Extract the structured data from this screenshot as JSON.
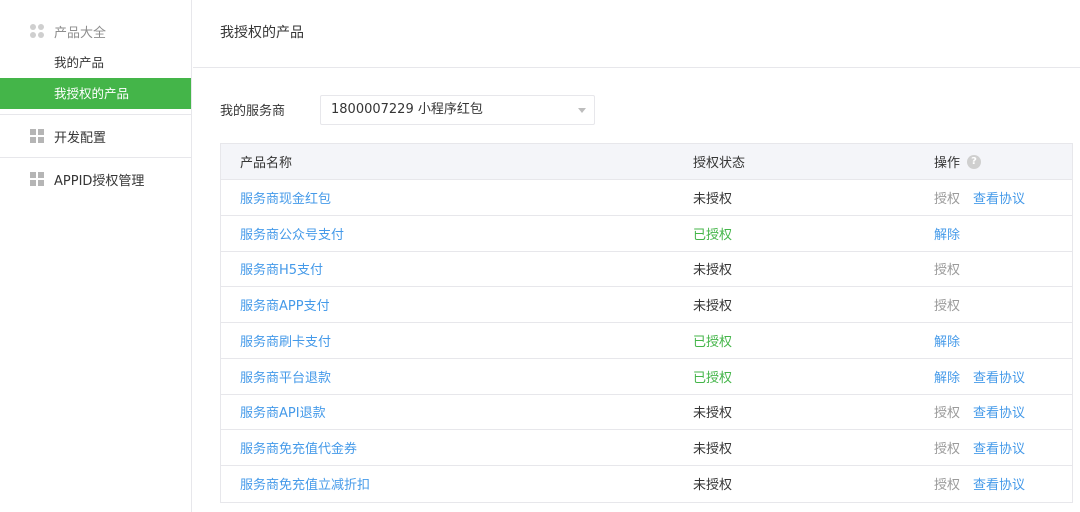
{
  "sidebar": {
    "section_title": "产品大全",
    "sub_items": [
      "我的产品",
      "我授权的产品"
    ],
    "groups": [
      "开发配置",
      "APPID授权管理"
    ]
  },
  "main": {
    "title": "我授权的产品",
    "provider_label": "我的服务商",
    "provider_value": "1800007229 小程序红包"
  },
  "table": {
    "headers": [
      "产品名称",
      "授权状态",
      "操作"
    ],
    "rows": [
      {
        "name": "服务商现金红包",
        "status": "未授权",
        "ops": [
          "授权",
          "查看协议"
        ]
      },
      {
        "name": "服务商公众号支付",
        "status": "已授权",
        "ops": [
          "解除"
        ]
      },
      {
        "name": "服务商H5支付",
        "status": "未授权",
        "ops": [
          "授权"
        ]
      },
      {
        "name": "服务商APP支付",
        "status": "未授权",
        "ops": [
          "授权"
        ]
      },
      {
        "name": "服务商刷卡支付",
        "status": "已授权",
        "ops": [
          "解除"
        ]
      },
      {
        "name": "服务商平台退款",
        "status": "已授权",
        "ops": [
          "解除",
          "查看协议"
        ]
      },
      {
        "name": "服务商API退款",
        "status": "未授权",
        "ops": [
          "授权",
          "查看协议"
        ]
      },
      {
        "name": "服务商免充值代金券",
        "status": "未授权",
        "ops": [
          "授权",
          "查看协议"
        ]
      },
      {
        "name": "服务商免充值立减折扣",
        "status": "未授权",
        "ops": [
          "授权",
          "查看协议"
        ]
      }
    ]
  },
  "colors": {
    "accent_green": "#44b549",
    "link_blue": "#459ae9",
    "muted_gray": "#9a9a9a"
  }
}
